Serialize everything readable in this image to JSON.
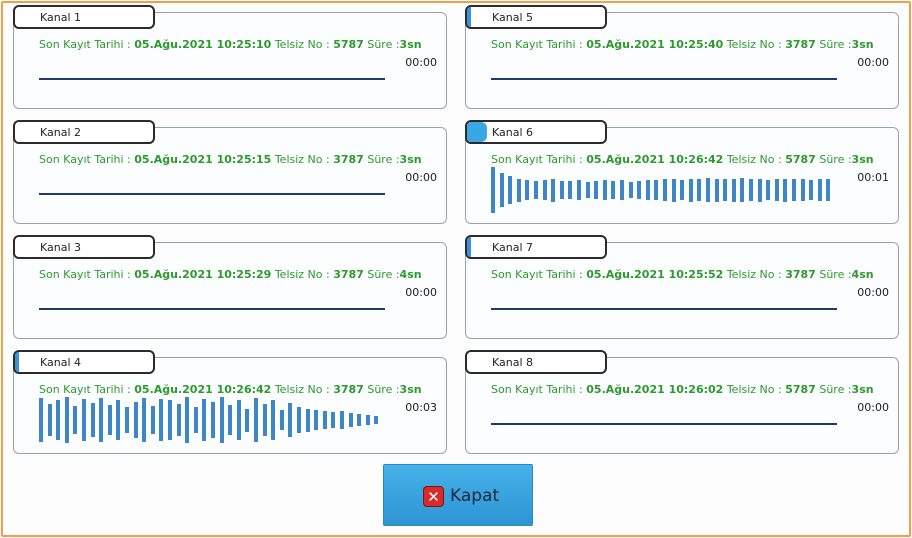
{
  "channels": [
    {
      "label": "Kanal 1",
      "prefix": "Son Kayıt Tarihi : ",
      "date": "05.Ağu.2021 10:25:10",
      "radio_label": " Telsiz No : ",
      "radio": "5787",
      "dur_label": " Süre :",
      "dur": "3sn",
      "timer": "00:00",
      "indicator": "none",
      "wave": []
    },
    {
      "label": "Kanal 2",
      "prefix": "Son Kayıt Tarihi : ",
      "date": "05.Ağu.2021 10:25:15",
      "radio_label": " Telsiz No : ",
      "radio": "3787",
      "dur_label": " Süre :",
      "dur": "3sn",
      "timer": "00:00",
      "indicator": "none",
      "wave": []
    },
    {
      "label": "Kanal 3",
      "prefix": "Son Kayıt Tarihi : ",
      "date": "05.Ağu.2021 10:25:29",
      "radio_label": " Telsiz No : ",
      "radio": "3787",
      "dur_label": " Süre :",
      "dur": "4sn",
      "timer": "00:00",
      "indicator": "none",
      "wave": []
    },
    {
      "label": "Kanal 4",
      "prefix": "Son Kayıt Tarihi : ",
      "date": "05.Ağu.2021 10:26:42",
      "radio_label": " Telsiz No : ",
      "radio": "3787",
      "dur_label": " Süre :",
      "dur": "3sn",
      "timer": "00:03",
      "indicator": "thin",
      "wave": [
        0.95,
        0.7,
        0.85,
        1.0,
        0.6,
        0.9,
        0.75,
        0.95,
        0.65,
        0.85,
        0.55,
        0.8,
        0.95,
        0.6,
        0.9,
        0.85,
        0.7,
        1.0,
        0.55,
        0.9,
        0.8,
        1.0,
        0.65,
        0.85,
        0.5,
        0.95,
        0.7,
        0.85,
        0.45,
        0.75,
        0.55,
        0.5,
        0.45,
        0.4,
        0.35,
        0.38,
        0.3,
        0.28,
        0.22,
        0.18
      ]
    },
    {
      "label": "Kanal 5",
      "prefix": "Son Kayıt Tarihi : ",
      "date": "05.Ağu.2021 10:25:40",
      "radio_label": " Telsiz No : ",
      "radio": "3787",
      "dur_label": " Süre :",
      "dur": "3sn",
      "timer": "00:00",
      "indicator": "thin",
      "wave": []
    },
    {
      "label": "Kanal 6",
      "prefix": "Son Kayıt Tarihi : ",
      "date": "05.Ağu.2021 10:26:42",
      "radio_label": " Telsiz No : ",
      "radio": "5787",
      "dur_label": " Süre :",
      "dur": "3sn",
      "timer": "00:01",
      "indicator": "big",
      "wave": [
        1.0,
        0.75,
        0.6,
        0.5,
        0.45,
        0.4,
        0.45,
        0.5,
        0.4,
        0.38,
        0.42,
        0.35,
        0.4,
        0.45,
        0.38,
        0.42,
        0.36,
        0.4,
        0.45,
        0.42,
        0.48,
        0.5,
        0.45,
        0.5,
        0.48,
        0.52,
        0.5,
        0.48,
        0.5,
        0.52,
        0.48,
        0.5,
        0.45,
        0.48,
        0.5,
        0.46,
        0.48,
        0.45,
        0.48,
        0.46
      ]
    },
    {
      "label": "Kanal 7",
      "prefix": "Son Kayıt Tarihi : ",
      "date": "05.Ağu.2021 10:25:52",
      "radio_label": " Telsiz No : ",
      "radio": "3787",
      "dur_label": " Süre :",
      "dur": "4sn",
      "timer": "00:00",
      "indicator": "thin",
      "wave": []
    },
    {
      "label": "Kanal 8",
      "prefix": "Son Kayıt Tarihi : ",
      "date": "05.Ağu.2021 10:26:02",
      "radio_label": " Telsiz No : ",
      "radio": "5787",
      "dur_label": " Süre :",
      "dur": "3sn",
      "timer": "00:00",
      "indicator": "none",
      "wave": []
    }
  ],
  "close_button": {
    "label": "Kapat",
    "icon": "close-x-icon",
    "icon_glyph": "✕"
  },
  "colors": {
    "frame": "#f0a04b",
    "info_text": "#2d9a2d",
    "wave": "#3e86c5",
    "line": "#1f3a6b",
    "button": "#39a7e4",
    "close_icon": "#d62b2b"
  }
}
